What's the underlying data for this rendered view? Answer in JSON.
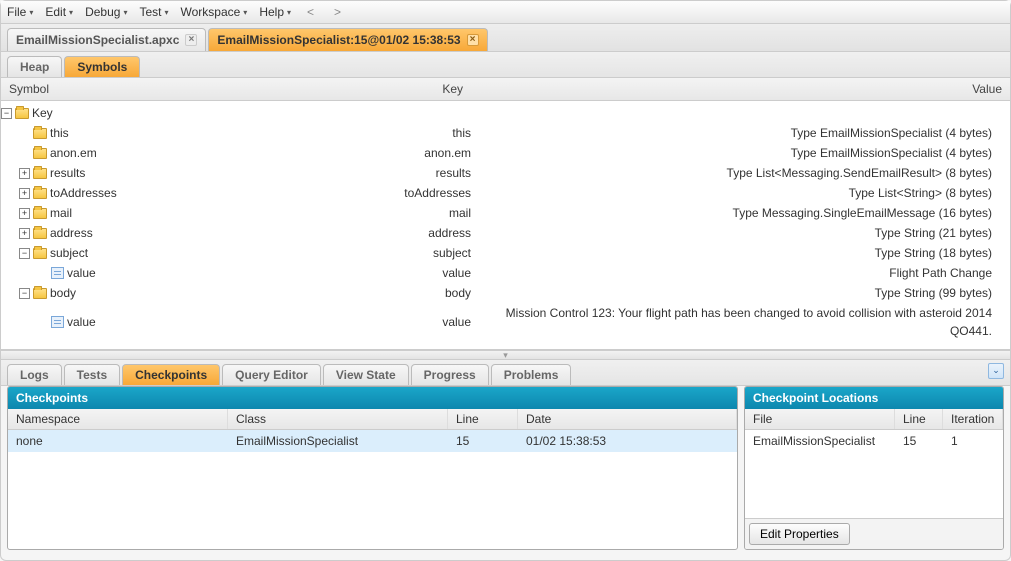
{
  "menubar": {
    "items": [
      "File",
      "Edit",
      "Debug",
      "Test",
      "Workspace",
      "Help"
    ],
    "nav_prev": "<",
    "nav_next": ">"
  },
  "filetabs": [
    {
      "label": "EmailMissionSpecialist.apxc",
      "active": false
    },
    {
      "label": "EmailMissionSpecialist:15@01/02 15:38:53",
      "active": true
    }
  ],
  "subtabs": {
    "heap": "Heap",
    "symbols": "Symbols"
  },
  "symbols_grid": {
    "headers": {
      "symbol": "Symbol",
      "key": "Key",
      "value": "Value"
    },
    "root": {
      "label": "Key"
    },
    "rows": [
      {
        "indent": 1,
        "toggle": "",
        "icon": "folder",
        "symbol": "this",
        "key": "this",
        "value": "Type EmailMissionSpecialist (4 bytes)"
      },
      {
        "indent": 1,
        "toggle": "",
        "icon": "folder",
        "symbol": "anon.em",
        "key": "anon.em",
        "value": "Type EmailMissionSpecialist (4 bytes)"
      },
      {
        "indent": 1,
        "toggle": "+",
        "icon": "folder",
        "symbol": "results",
        "key": "results",
        "value": "Type List<Messaging.SendEmailResult> (8 bytes)"
      },
      {
        "indent": 1,
        "toggle": "+",
        "icon": "folder",
        "symbol": "toAddresses",
        "key": "toAddresses",
        "value": "Type List<String> (8 bytes)"
      },
      {
        "indent": 1,
        "toggle": "+",
        "icon": "folder",
        "symbol": "mail",
        "key": "mail",
        "value": "Type Messaging.SingleEmailMessage (16 bytes)"
      },
      {
        "indent": 1,
        "toggle": "+",
        "icon": "folder",
        "symbol": "address",
        "key": "address",
        "value": "Type String (21 bytes)"
      },
      {
        "indent": 1,
        "toggle": "−",
        "icon": "folder",
        "symbol": "subject",
        "key": "subject",
        "value": "Type String (18 bytes)"
      },
      {
        "indent": 2,
        "toggle": "",
        "icon": "leaf",
        "symbol": "value",
        "key": "value",
        "value": "Flight Path Change"
      },
      {
        "indent": 1,
        "toggle": "−",
        "icon": "folder",
        "symbol": "body",
        "key": "body",
        "value": "Type String (99 bytes)"
      },
      {
        "indent": 2,
        "toggle": "",
        "icon": "leaf",
        "symbol": "value",
        "key": "value",
        "value": "Mission Control 123: Your flight path has been changed to avoid collision with asteroid 2014 QO441."
      }
    ]
  },
  "bottom_tabs": [
    "Logs",
    "Tests",
    "Checkpoints",
    "Query Editor",
    "View State",
    "Progress",
    "Problems"
  ],
  "bottom_active": "Checkpoints",
  "checkpoints_panel": {
    "title": "Checkpoints",
    "headers": {
      "ns": "Namespace",
      "class": "Class",
      "line": "Line",
      "date": "Date"
    },
    "rows": [
      {
        "ns": "none",
        "class": "EmailMissionSpecialist",
        "line": "15",
        "date": "01/02 15:38:53"
      }
    ]
  },
  "locations_panel": {
    "title": "Checkpoint Locations",
    "headers": {
      "file": "File",
      "line": "Line",
      "iter": "Iteration"
    },
    "rows": [
      {
        "file": "EmailMissionSpecialist",
        "line": "15",
        "iter": "1"
      }
    ],
    "edit_btn": "Edit Properties"
  }
}
